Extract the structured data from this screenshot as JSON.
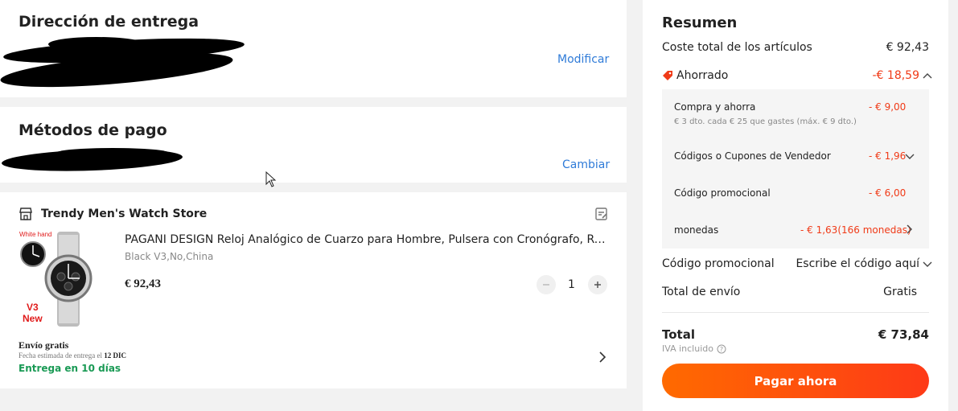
{
  "address": {
    "title": "Dirección de entrega",
    "action": "Modificar"
  },
  "payment": {
    "title": "Métodos de pago",
    "action": "Cambiar"
  },
  "order": {
    "store_name": "Trendy Men's Watch Store",
    "product_title": "PAGANI DESIGN Reloj Analógico de Cuarzo para Hombre, Pulsera con Cronógrafo, Resistente al agua",
    "variant": "Black V3,No,China",
    "price": "€ 92,43",
    "quantity": "1",
    "image_tag_top": "White hand",
    "image_tag_v3": "V3",
    "image_tag_new": "New",
    "shipping_free": "Envío gratis",
    "delivery_estimate_prefix": "Fecha estimada de entrega el",
    "delivery_estimate_date": "12 DIC",
    "delivery_days": "Entrega en 10 días"
  },
  "summary": {
    "title": "Resumen",
    "items_total_label": "Coste total de los artículos",
    "items_total_value": "€ 92,43",
    "saved_label": "Ahorrado",
    "saved_value": "-€ 18,59",
    "discounts": {
      "buy_save_label": "Compra y ahorra",
      "buy_save_value": "- € 9,00",
      "buy_save_hint": "€ 3 dto. cada € 25 que gastes (máx. € 9 dto.)",
      "seller_codes_label": "Códigos o Cupones de Vendedor",
      "seller_codes_value": "- € 1,96",
      "promo_label": "Código promocional",
      "promo_value": "- € 6,00",
      "coins_label": "monedas",
      "coins_value": "- € 1,63(166 monedas)"
    },
    "promo_code_label": "Código promocional",
    "promo_code_placeholder": "Escribe el código aquí",
    "shipping_label": "Total de envío",
    "shipping_value": "Gratis",
    "total_label": "Total",
    "total_value": "€ 73,84",
    "vat_label": "IVA incluido",
    "pay_button": "Pagar ahora"
  },
  "colors": {
    "accent_red": "#f03a17",
    "link_blue": "#2f7bd8",
    "green": "#1a9a55",
    "button_start": "#ff6a00",
    "button_end": "#fe3a17"
  },
  "icons": [
    "store-icon",
    "note-icon",
    "tag-icon",
    "chevron-up-icon",
    "chevron-down-icon",
    "chevron-right-icon",
    "info-icon",
    "minus-icon",
    "plus-icon"
  ]
}
